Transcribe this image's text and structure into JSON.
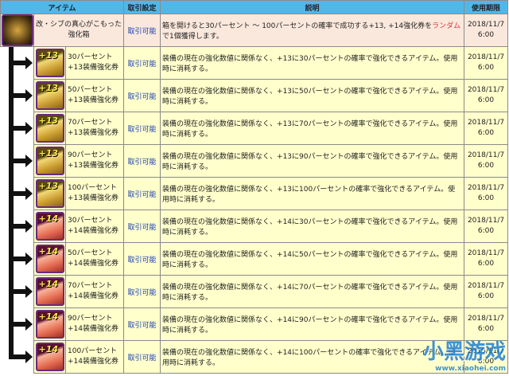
{
  "header": {
    "item": "アイテム",
    "trade": "取引設定",
    "desc": "説明",
    "expiry": "使用期限"
  },
  "box": {
    "name": "改・シブの真心がこもった強化箱",
    "trade": "取引可能",
    "desc_pre": "箱を開けると30パーセント ～ 100パーセントの確率で成功する+13, +14強化券を",
    "desc_red": "ランダム",
    "desc_post": "で1個獲得します。",
    "date": "2018/11/7",
    "time": "6:00"
  },
  "items": [
    {
      "icon": "+13",
      "line1": "30パーセント",
      "line2": "+13装備強化券",
      "trade": "取引可能",
      "desc": "装備の現在の強化数値に関係なく、+13に30パーセントの確率で強化できるアイテム。使用時に消耗する。",
      "date": "2018/11/7",
      "time": "6:00"
    },
    {
      "icon": "+13",
      "line1": "50パーセント",
      "line2": "+13装備強化券",
      "trade": "取引可能",
      "desc": "装備の現在の強化数値に関係なく、+13に50パーセントの確率で強化できるアイテム。使用時に消耗する。",
      "date": "2018/11/7",
      "time": "6:00"
    },
    {
      "icon": "+13",
      "line1": "70パーセント",
      "line2": "+13装備強化券",
      "trade": "取引可能",
      "desc": "装備の現在の強化数値に関係なく、+13に70パーセントの確率で強化できるアイテム。使用時に消耗する。",
      "date": "2018/11/7",
      "time": "6:00"
    },
    {
      "icon": "+13",
      "line1": "90パーセント",
      "line2": "+13装備強化券",
      "trade": "取引可能",
      "desc": "装備の現在の強化数値に関係なく、+13に90パーセントの確率で強化できるアイテム。使用時に消耗する。",
      "date": "2018/11/7",
      "time": "6:00"
    },
    {
      "icon": "+13",
      "line1": "100パーセント",
      "line2": "+13装備強化券",
      "trade": "取引可能",
      "desc": "装備の現在の強化数値に関係なく、+13に100パーセントの確率で強化できるアイテム。使用時に消耗する。",
      "date": "2018/11/7",
      "time": "6:00"
    },
    {
      "icon": "+14",
      "line1": "30パーセント",
      "line2": "+14装備強化券",
      "trade": "取引可能",
      "desc": "装備の現在の強化数値に関係なく、+14に30パーセントの確率で強化できるアイテム。使用時に消耗する。",
      "date": "2018/11/7",
      "time": "6:00"
    },
    {
      "icon": "+14",
      "line1": "50パーセント",
      "line2": "+14装備強化券",
      "trade": "取引可能",
      "desc": "装備の現在の強化数値に関係なく、+14に50パーセントの確率で強化できるアイテム。使用時に消耗する。",
      "date": "2018/11/7",
      "time": "6:00"
    },
    {
      "icon": "+14",
      "line1": "70パーセント",
      "line2": "+14装備強化券",
      "trade": "取引可能",
      "desc": "装備の現在の強化数値に関係なく、+14に70パーセントの確率で強化できるアイテム。使用時に消耗する。",
      "date": "2018/11/7",
      "time": "6:00"
    },
    {
      "icon": "+14",
      "line1": "90パーセント",
      "line2": "+14装備強化券",
      "trade": "取引可能",
      "desc": "装備の現在の強化数値に関係なく、+14に90パーセントの確率で強化できるアイテム。使用時に消耗する。",
      "date": "2018/11/7",
      "time": "6:00"
    },
    {
      "icon": "+14",
      "line1": "100パーセント",
      "line2": "+14装備強化券",
      "trade": "取引可能",
      "desc": "装備の現在の強化数値に関係なく、+14に100パーセントの確率で強化できるアイテム。使用時に消耗する。",
      "date": "2018/11/7",
      "time": "6:00"
    }
  ],
  "watermark": {
    "logo": "小黑游戏",
    "url": "www.xiaohei.com"
  },
  "colors": {
    "header": "#52b7e8",
    "box_row": "#fbe8dc",
    "item_row": "#ffffcc",
    "trade_link": "#1a3fb0",
    "highlight": "#e0303a"
  }
}
